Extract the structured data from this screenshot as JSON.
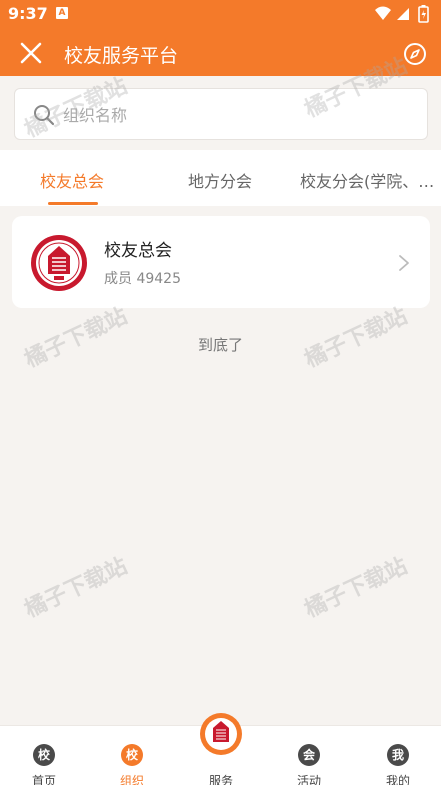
{
  "status_bar": {
    "time": "9:37",
    "notification_letter": "A"
  },
  "header": {
    "title": "校友服务平台"
  },
  "search": {
    "placeholder": "组织名称",
    "value": ""
  },
  "tabs": [
    {
      "label": "校友总会",
      "active": true
    },
    {
      "label": "地方分会",
      "active": false
    },
    {
      "label": "校友分会(学院、…",
      "active": false
    }
  ],
  "org_list": [
    {
      "name": "校友总会",
      "members_label": "成员",
      "members_count": "49425"
    }
  ],
  "list_end_text": "到底了",
  "watermark": "橘子下载站",
  "bottom_nav": [
    {
      "label": "首页",
      "icon_char": "校",
      "active": false
    },
    {
      "label": "组织",
      "icon_char": "校",
      "active": true
    },
    {
      "label": "服务",
      "icon_char": "",
      "active": false
    },
    {
      "label": "活动",
      "icon_char": "会",
      "active": false
    },
    {
      "label": "我的",
      "icon_char": "我",
      "active": false
    }
  ],
  "colors": {
    "accent": "#f47a2a",
    "background": "#f6f3f0",
    "logo_red": "#c8192e"
  }
}
